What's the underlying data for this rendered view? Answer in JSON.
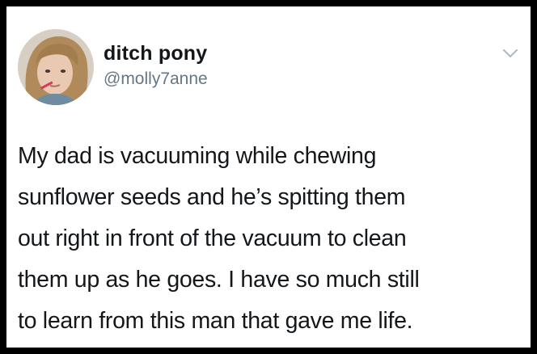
{
  "tweet": {
    "author": {
      "display_name": "ditch pony",
      "handle": "@molly7anne",
      "avatar_icon": "profile-photo-avatar"
    },
    "menu_icon": "chevron-down-icon",
    "text_lines": [
      "My dad is vacuuming while chewing",
      "sunflower seeds and he’s spitting them",
      "out right in front of the vacuum to clean",
      "them up as he goes. I have so much still",
      "to learn from this man that gave me life."
    ]
  },
  "colors": {
    "frame": "#000000",
    "background": "#ffffff",
    "name_text": "#14171a",
    "handle_text": "#657786",
    "chevron": "#aab8c2"
  }
}
